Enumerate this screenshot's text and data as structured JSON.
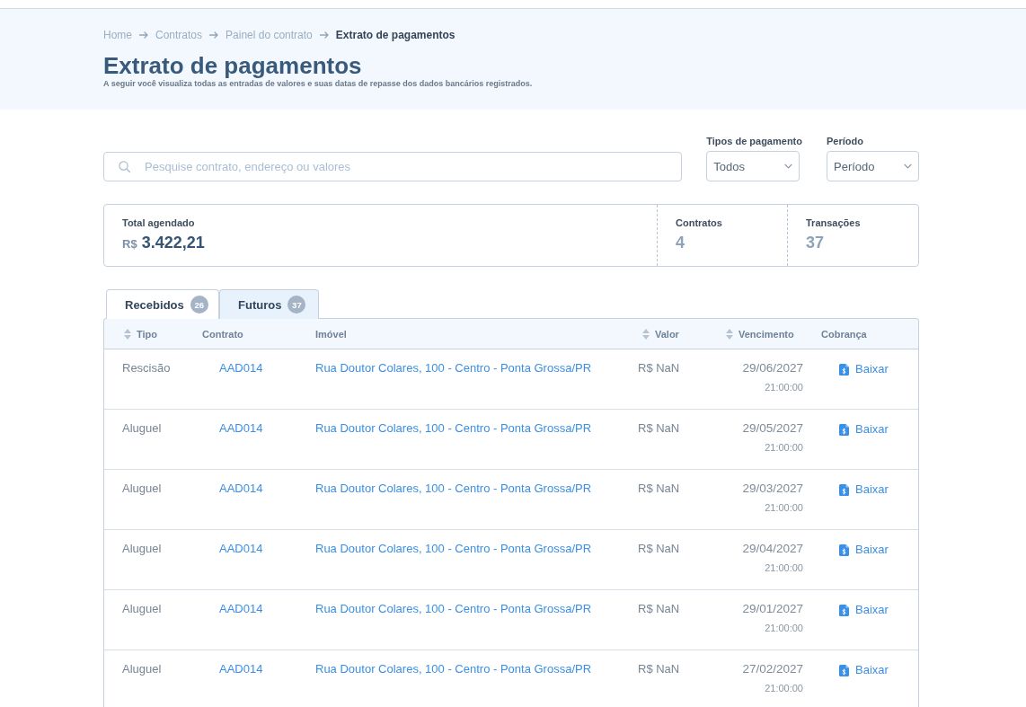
{
  "breadcrumb": [
    {
      "label": "Home",
      "current": false
    },
    {
      "label": "Contratos",
      "current": false
    },
    {
      "label": "Painel do contrato",
      "current": false
    },
    {
      "label": "Extrato de pagamentos",
      "current": true
    }
  ],
  "page": {
    "title": "Extrato de pagamentos",
    "subtitle": "A seguir você visualiza todas as entradas de valores e suas datas de repasse dos dados bancários registrados."
  },
  "search": {
    "placeholder": "Pesquise contrato, endereço ou valores"
  },
  "filters": [
    {
      "label": "Tipos de pagamento",
      "value": "Todos"
    },
    {
      "label": "Período",
      "value": "Período"
    }
  ],
  "summary": [
    {
      "kind": "money",
      "label": "Total agendado",
      "currency": "R$",
      "value": "3.422,21"
    },
    {
      "kind": "count",
      "label": "Contratos",
      "value": "4"
    },
    {
      "kind": "count",
      "label": "Transações",
      "value": "37"
    }
  ],
  "tabs": [
    {
      "label": "Recebidos",
      "count": "26",
      "selected": false
    },
    {
      "label": "Futuros",
      "count": "37",
      "selected": true
    }
  ],
  "table": {
    "columns": [
      {
        "label": "Tipo",
        "sortable": true
      },
      {
        "label": "Contrato",
        "sortable": false
      },
      {
        "label": "Imóvel",
        "sortable": false
      },
      {
        "label": "Valor",
        "sortable": true
      },
      {
        "label": "Vencimento",
        "sortable": true
      },
      {
        "label": "Cobrança",
        "sortable": false
      }
    ],
    "rows": [
      {
        "tipo": "Rescisão",
        "contrato": "AAD014",
        "imovel": "Rua Doutor Colares, 100 - Centro - Ponta Grossa/PR",
        "valor": "R$ NaN",
        "date": "29/06/2027",
        "time": "21:00:00",
        "action": "Baixar"
      },
      {
        "tipo": "Aluguel",
        "contrato": "AAD014",
        "imovel": "Rua Doutor Colares, 100 - Centro - Ponta Grossa/PR",
        "valor": "R$ NaN",
        "date": "29/05/2027",
        "time": "21:00:00",
        "action": "Baixar"
      },
      {
        "tipo": "Aluguel",
        "contrato": "AAD014",
        "imovel": "Rua Doutor Colares, 100 - Centro - Ponta Grossa/PR",
        "valor": "R$ NaN",
        "date": "29/03/2027",
        "time": "21:00:00",
        "action": "Baixar"
      },
      {
        "tipo": "Aluguel",
        "contrato": "AAD014",
        "imovel": "Rua Doutor Colares, 100 - Centro - Ponta Grossa/PR",
        "valor": "R$ NaN",
        "date": "29/04/2027",
        "time": "21:00:00",
        "action": "Baixar"
      },
      {
        "tipo": "Aluguel",
        "contrato": "AAD014",
        "imovel": "Rua Doutor Colares, 100 - Centro - Ponta Grossa/PR",
        "valor": "R$ NaN",
        "date": "29/01/2027",
        "time": "21:00:00",
        "action": "Baixar"
      },
      {
        "tipo": "Aluguel",
        "contrato": "AAD014",
        "imovel": "Rua Doutor Colares, 100 - Centro - Ponta Grossa/PR",
        "valor": "R$ NaN",
        "date": "27/02/2027",
        "time": "21:00:00",
        "action": "Baixar"
      }
    ]
  }
}
